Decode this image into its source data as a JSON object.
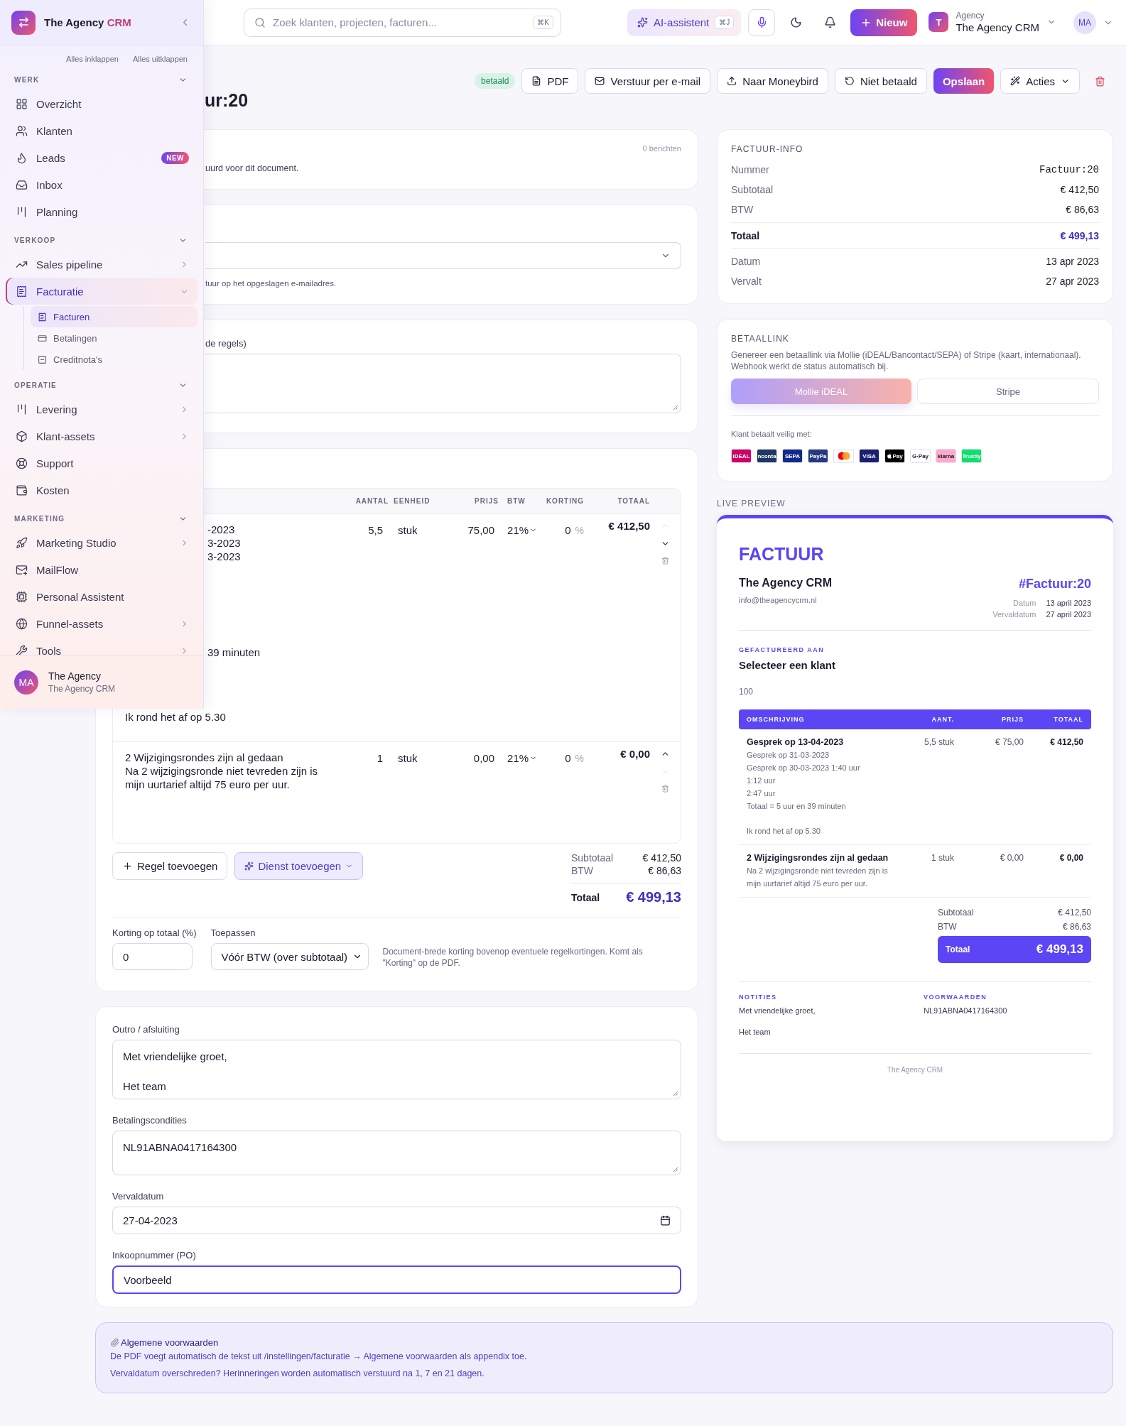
{
  "sidebar": {
    "brand": {
      "name": "The Agency",
      "accent": "CRM"
    },
    "tree_actions": [
      "Alles inklappen",
      "Alles uitklappen"
    ],
    "sections": [
      {
        "title": "WERK",
        "expanded": true,
        "items": [
          {
            "label": "Overzicht",
            "kind": "link",
            "selected": false
          },
          {
            "label": "Klanten",
            "kind": "link",
            "selected": false
          },
          {
            "label": "Leads",
            "kind": "link",
            "badge": "NEW",
            "selected": false
          },
          {
            "label": "Inbox",
            "kind": "link",
            "selected": false
          },
          {
            "label": "Planning",
            "kind": "link",
            "selected": false
          }
        ]
      },
      {
        "title": "VERKOOP",
        "expanded": true,
        "items": [
          {
            "label": "Sales pipeline",
            "kind": "group",
            "expanded": false,
            "selected": false
          },
          {
            "label": "Facturatie",
            "kind": "group",
            "expanded": true,
            "selected": true,
            "children": [
              {
                "label": "Facturen",
                "selected": true
              },
              {
                "label": "Betalingen",
                "selected": false
              },
              {
                "label": "Creditnota's",
                "selected": false
              }
            ]
          }
        ]
      },
      {
        "title": "OPERATIE",
        "expanded": true,
        "items": [
          {
            "label": "Levering",
            "kind": "group",
            "expanded": false,
            "selected": false
          },
          {
            "label": "Klant-assets",
            "kind": "group",
            "expanded": false,
            "selected": false
          },
          {
            "label": "Support",
            "kind": "link",
            "selected": false
          },
          {
            "label": "Kosten",
            "kind": "link",
            "selected": false
          }
        ]
      },
      {
        "title": "MARKETING",
        "expanded": true,
        "items": [
          {
            "label": "Marketing Studio",
            "kind": "group",
            "expanded": false,
            "selected": false
          },
          {
            "label": "MailFlow",
            "kind": "link",
            "selected": false
          },
          {
            "label": "Personal Assistent",
            "kind": "link",
            "selected": false
          },
          {
            "label": "Funnel-assets",
            "kind": "group",
            "expanded": false,
            "selected": false
          },
          {
            "label": "Tools",
            "kind": "group",
            "expanded": false,
            "selected": false
          }
        ]
      }
    ],
    "footer": {
      "avatar": "MA",
      "name": "The Agency",
      "subtitle": "The Agency CRM"
    }
  },
  "topbar": {
    "search": {
      "placeholder": "Zoek klanten, projecten, facturen...",
      "shortcut": "⌘K"
    },
    "assistant": {
      "label": "AI-assistent",
      "shortcut": "⌘J"
    },
    "new_button": "Nieuw",
    "workspace": {
      "initial": "T",
      "label": "Agency",
      "name": "The Agency CRM"
    },
    "avatar": "MA"
  },
  "header": {
    "title": "ur:20",
    "status": "betaald",
    "actions": [
      {
        "label": "PDF",
        "kind": "outline"
      },
      {
        "label": "Verstuur per e-mail",
        "kind": "outline"
      },
      {
        "label": "Naar Moneybird",
        "kind": "outline"
      },
      {
        "label": "Niet betaald",
        "kind": "outline"
      },
      {
        "label": "Opslaan",
        "kind": "primary"
      },
      {
        "label": "Acties",
        "kind": "menu"
      }
    ]
  },
  "messages_card": {
    "count": "0 berichten",
    "text": "uurd voor dit document."
  },
  "send_card": {
    "hint": "tuur op het opgeslagen e-mailadres."
  },
  "intro_card": {
    "label": "de regels)"
  },
  "lines_card": {
    "columns": [
      "AANTAL",
      "EENHEID",
      "PRIJS",
      "BTW",
      "KORTING",
      "TOTAAL"
    ],
    "rows": [
      {
        "description_fragments": [
          [
            "-2023",
            "3-2023",
            "3-2023"
          ],
          [
            "39 minuten"
          ],
          [
            "Ik rond het af op 5.30"
          ]
        ],
        "quantity": "5,5",
        "unit": "stuk",
        "price": "75,00",
        "vat": "21%",
        "discount": "0",
        "discount_unit": "%",
        "total": "€ 412,50",
        "up_disabled": true,
        "down_disabled": false
      },
      {
        "description": [
          "2 Wijzigingsrondes zijn al gedaan",
          "Na 2 wijzigingsronde niet tevreden zijn is",
          "mijn uurtarief altijd 75 euro per uur."
        ],
        "quantity": "1",
        "unit": "stuk",
        "price": "0,00",
        "vat": "21%",
        "discount": "0",
        "discount_unit": "%",
        "total": "€ 0,00",
        "up_disabled": false,
        "down_disabled": true
      }
    ],
    "add_line": "Regel toevoegen",
    "add_service": "Dienst toevoegen",
    "totals": {
      "subtotal_label": "Subtotaal",
      "subtotal": "€ 412,50",
      "vat_label": "BTW",
      "vat": "€ 86,63",
      "total_label": "Totaal",
      "total": "€ 499,13"
    },
    "discount": {
      "label": "Korting op totaal (%)",
      "value": "0",
      "apply_label": "Toepassen",
      "apply_value": "Vóór BTW (over subtotaal)",
      "hint": "Document-brede korting bovenop eventuele regelkortingen. Komt als \"Korting\" op de PDF."
    }
  },
  "closing_card": {
    "fields": [
      {
        "kind": "textarea",
        "label": "Outro / afsluiting",
        "value": [
          "Met vriendelijke groet,",
          "Het team"
        ],
        "focused": false
      },
      {
        "kind": "textarea",
        "label": "Betalingscondities",
        "value": [
          "NL91ABNA0417164300"
        ],
        "focused": false
      },
      {
        "kind": "date",
        "label": "Vervaldatum",
        "value": [
          "27-04-2023"
        ],
        "focused": false
      },
      {
        "kind": "text",
        "label": "Inkoopnummer (PO)",
        "value": [
          "Voorbeeld"
        ],
        "focused": true
      }
    ]
  },
  "notice": {
    "title": "Algemene voorwaarden",
    "lines": [
      "De PDF voegt automatisch de tekst uit /instellingen/facturatie → Algemene voorwaarden als appendix toe.",
      "Vervaldatum overschreden? Herinneringen worden automatisch verstuurd na 1, 7 en 21 dagen."
    ]
  },
  "info_card": {
    "title": "FACTUUR-INFO",
    "rows": [
      {
        "label": "Nummer",
        "value": "Factuur:20",
        "kind": "mono"
      },
      {
        "label": "Subtotaal",
        "value": "€ 412,50",
        "kind": "plain"
      },
      {
        "label": "BTW",
        "value": "€ 86,63",
        "kind": "plain"
      },
      {
        "label": "Totaal",
        "value": "€ 499,13",
        "kind": "total"
      },
      {
        "label": "Datum",
        "value": "13 apr 2023",
        "kind": "plain"
      },
      {
        "label": "Vervalt",
        "value": "27 apr 2023",
        "kind": "plain"
      }
    ]
  },
  "payment_card": {
    "title": "BETAALLINK",
    "description": "Genereer een betaallink via Mollie (iDEAL/Bancontact/SEPA) of Stripe (kaart, internationaal). Webhook werkt de status automatisch bij.",
    "providers": [
      {
        "label": "Mollie iDEAL",
        "selected": true
      },
      {
        "label": "Stripe",
        "selected": false
      }
    ],
    "methods_label": "Klant betaalt veilig met:",
    "methods": [
      {
        "kind": "label",
        "label": "iDEAL",
        "color": "#cc0066"
      },
      {
        "kind": "label",
        "label": "nconta",
        "color": "#1e3764"
      },
      {
        "kind": "label",
        "label": "SEPA",
        "color": "#10298e"
      },
      {
        "kind": "label",
        "label": "PayPa",
        "color": "#253b80"
      },
      {
        "kind": "mastercard",
        "color": "#ffffff"
      },
      {
        "kind": "label",
        "label": "VISA",
        "color": "#1a1f71"
      },
      {
        "kind": "applepay",
        "label": "Pay",
        "color": "#000000"
      },
      {
        "kind": "label",
        "label": "G·Pay",
        "color": "#ffffff"
      },
      {
        "kind": "label",
        "label": "klarna",
        "color": "#ffa8cd"
      },
      {
        "kind": "label",
        "label": "Trustly",
        "color": "#0ee06e"
      }
    ]
  },
  "preview": {
    "label": "LIVE PREVIEW",
    "heading": "FACTUUR",
    "company": "The Agency CRM",
    "email": "info@theagencycrm.nl",
    "number": "#Factuur:20",
    "meta": [
      {
        "label": "Datum",
        "value": "13 april 2023"
      },
      {
        "label": "Vervaldatum",
        "value": "27 april 2023"
      }
    ],
    "billed_to_label": "GEFACTUREERD AAN",
    "client": "Selecteer een klant",
    "client_extra": "100",
    "columns": [
      "OMSCHRIJVING",
      "AANT.",
      "PRIJS",
      "TOTAAL"
    ],
    "rows": [
      {
        "title": "Gesprek op 13-04-2023",
        "paragraphs": [
          [
            "Gesprek op 31-03-2023",
            "Gesprek op 30-03-2023 1:40 uur",
            "1:12 uur",
            "2:47 uur",
            "Totaal = 5 uur en 39 minuten"
          ],
          [
            "Ik rond het af op 5.30"
          ]
        ],
        "quantity": "5,5 stuk",
        "price": "€ 75,00",
        "total": "€ 412,50"
      },
      {
        "title": "2 Wijzigingsrondes zijn al gedaan",
        "paragraphs": [
          [
            "Na 2 wijzigingsronde niet tevreden zijn is mijn uurtarief altijd 75 euro per uur."
          ]
        ],
        "quantity": "1 stuk",
        "price": "€ 0,00",
        "total": "€ 0,00"
      }
    ],
    "totals": {
      "subtotal_label": "Subtotaal",
      "subtotal": "€ 412,50",
      "vat_label": "BTW",
      "vat": "€ 86,63",
      "total_label": "Totaal",
      "total": "€ 499,13"
    },
    "notes": {
      "label": "NOTITIES",
      "paragraphs": [
        "Met vriendelijke groet,",
        "Het team"
      ]
    },
    "terms": {
      "label": "VOORWAARDEN",
      "text": "NL91ABNA0417164300"
    },
    "footer": "The Agency CRM"
  }
}
